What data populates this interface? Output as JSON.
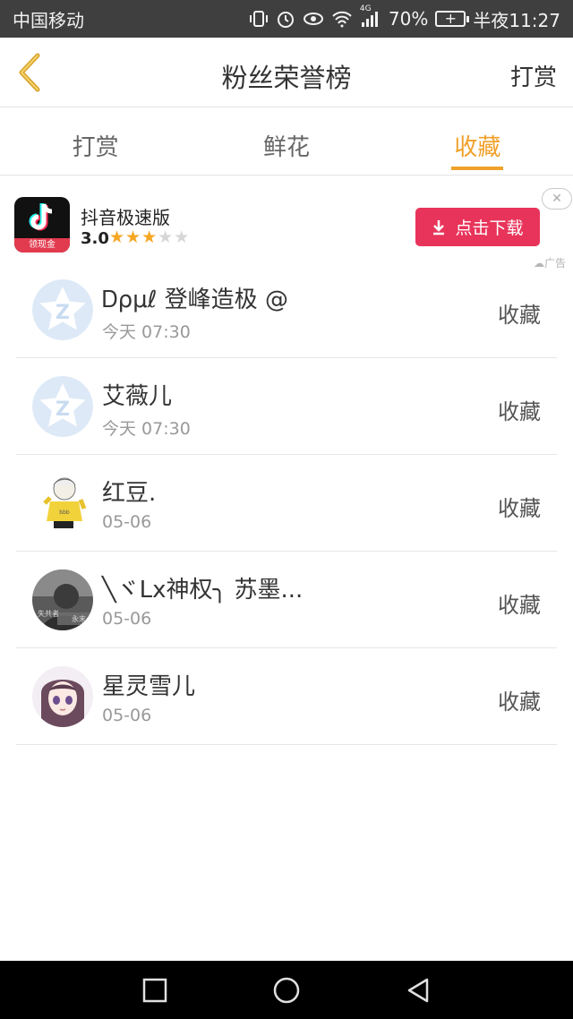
{
  "status_bar": {
    "carrier": "中国移动",
    "network": "4G",
    "battery": "70%",
    "time": "半夜11:27"
  },
  "header": {
    "back_icon": "chevron-left-icon",
    "title": "粉丝荣誉榜",
    "right_action": "打赏"
  },
  "tabs": [
    {
      "label": "打赏",
      "active": false
    },
    {
      "label": "鲜花",
      "active": false
    },
    {
      "label": "收藏",
      "active": true
    }
  ],
  "ad": {
    "app_name": "抖音极速版",
    "app_icon_badge": "领现金",
    "rating": "3.0",
    "rating_value": 3,
    "rating_max": 5,
    "download_label": "点击下载",
    "close_icon": "close-icon",
    "ad_label": "广告"
  },
  "list": [
    {
      "name": "Ꭰρμℓ 登峰造极 @",
      "date": "今天 07:30",
      "action": "收藏",
      "avatar": "default-star-avatar"
    },
    {
      "name": "艾薇儿",
      "date": "今天 07:30",
      "action": "收藏",
      "avatar": "default-star-avatar"
    },
    {
      "name": "红豆.",
      "date": "05-06",
      "action": "收藏",
      "avatar": "cartoon-avatar"
    },
    {
      "name": "╲ヾLx神权╮ 苏墨...",
      "date": "05-06",
      "action": "收藏",
      "avatar": "photo-avatar"
    },
    {
      "name": "星灵雪儿",
      "date": "05-06",
      "action": "收藏",
      "avatar": "anime-girl-avatar"
    }
  ],
  "navbar": {
    "buttons": [
      "recents-icon",
      "home-icon",
      "back-icon"
    ]
  },
  "colors": {
    "accent": "#f0a12a",
    "download_button": "#e8345a",
    "status_bar": "#3f3f3f",
    "navbar": "#000000"
  }
}
